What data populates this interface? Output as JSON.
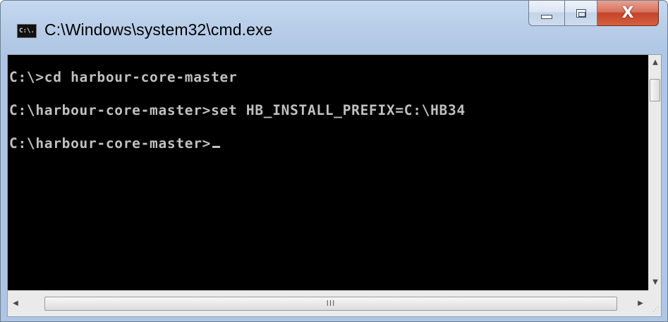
{
  "window": {
    "title": "C:\\Windows\\system32\\cmd.exe",
    "icon_label": "C:\\."
  },
  "caption_buttons": {
    "minimize": "minimize-icon",
    "maximize": "maximize-icon",
    "close_glyph": "X"
  },
  "console": {
    "lines": [
      "C:\\>cd harbour-core-master",
      "C:\\harbour-core-master>set HB_INSTALL_PREFIX=C:\\HB34",
      "C:\\harbour-core-master>"
    ],
    "background_color": "#000000",
    "text_color": "#c0c0c0"
  },
  "scrollbars": {
    "up_arrow": "▲",
    "down_arrow": "▼",
    "left_arrow": "◀",
    "right_arrow": "▶",
    "thumb_grip": "III",
    "resize_grip": "⋰"
  }
}
